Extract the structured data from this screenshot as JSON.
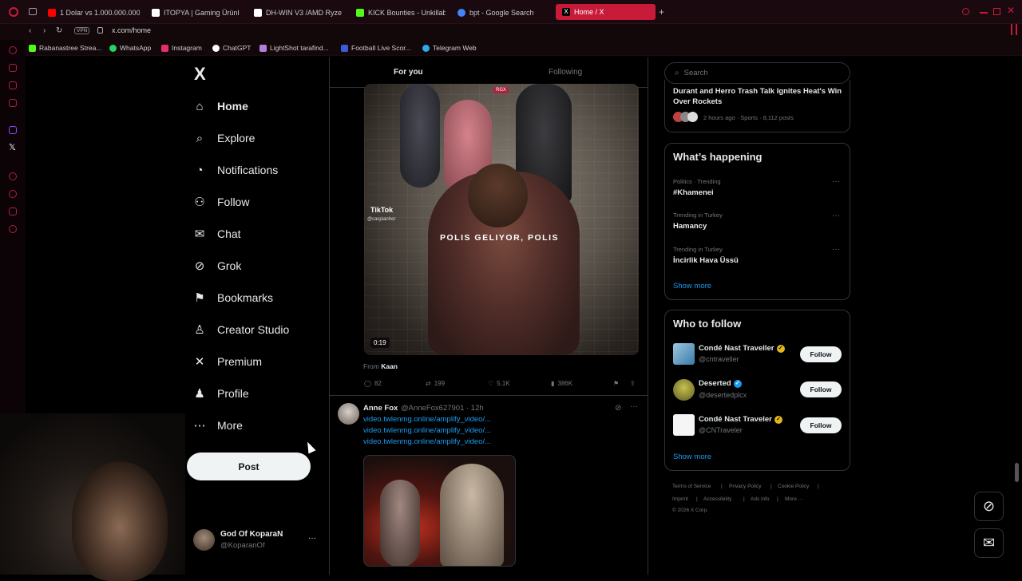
{
  "browser": {
    "tabs": [
      {
        "label": "1 Dolar vs 1.000.000.000 D",
        "color": "#ff0000"
      },
      {
        "label": "ITOPYA | Gaming Ürünler",
        "color": "#ffffff"
      },
      {
        "label": "DH-WIN V3 /AMD Ryzen",
        "color": "#ffffff"
      },
      {
        "label": "KICK Bounties - Unkillable",
        "color": "#53fc18"
      },
      {
        "label": "bpt - Google Search",
        "color": "#4285f4"
      },
      {
        "label": "Home / X",
        "color": "#000000"
      }
    ],
    "new_tab": "+",
    "url": "x.com/home",
    "vpn_label": "VPN",
    "bookmarks": [
      {
        "label": "Rabanastree Strea...",
        "color": "#53fc18"
      },
      {
        "label": "WhatsApp",
        "color": "#25d366"
      },
      {
        "label": "Instagram",
        "color": "#e1306c"
      },
      {
        "label": "ChatGPT",
        "color": "#ffffff"
      },
      {
        "label": "LightShot tarafind...",
        "color": "#b57edc"
      },
      {
        "label": "Football Live Scor...",
        "color": "#3b5bdb"
      },
      {
        "label": "Telegram Web",
        "color": "#2aabee"
      }
    ]
  },
  "nav": {
    "logo": "X",
    "items": [
      {
        "label": "Home",
        "icon": "home-icon"
      },
      {
        "label": "Explore",
        "icon": "search-icon"
      },
      {
        "label": "Notifications",
        "icon": "bell-icon"
      },
      {
        "label": "Follow",
        "icon": "person-add-icon"
      },
      {
        "label": "Chat",
        "icon": "mail-icon"
      },
      {
        "label": "Grok",
        "icon": "grok-icon"
      },
      {
        "label": "Bookmarks",
        "icon": "bookmark-icon"
      },
      {
        "label": "Creator Studio",
        "icon": "creator-icon"
      },
      {
        "label": "Premium",
        "icon": "x-icon"
      },
      {
        "label": "Profile",
        "icon": "person-icon"
      },
      {
        "label": "More",
        "icon": "more-icon"
      }
    ],
    "post_label": "Post",
    "account": {
      "name": "God Of KoparaN",
      "handle": "@KoparanOf",
      "more": "···"
    }
  },
  "feed": {
    "tabs": [
      "For you",
      "Following"
    ],
    "video_post": {
      "badge": "RGX",
      "tiktok_label": "TikTok",
      "tiktok_handle": "@caspianher",
      "caption": "POLIS GELIYOR, POLIS",
      "duration": "0:19",
      "from_label": "From",
      "from_name": "Kaan",
      "replies": "82",
      "reposts": "199",
      "likes": "5.1K",
      "views": "386K"
    },
    "second_post": {
      "name": "Anne Fox",
      "handle_time": "@AnneFox627901 · 12h",
      "links": [
        "video.twlenmg.online/amplify_video/...",
        "video.twlenmg.online/amplify_video/...",
        "video.twlenmg.online/amplify_video/..."
      ]
    }
  },
  "right": {
    "search_placeholder": "Search",
    "top_story": {
      "title": "Durant and Herro Trash Talk Ignites Heat's Win Over Rockets",
      "meta": "2 hours ago · Sports · 8,112 posts"
    },
    "happening": {
      "title": "What’s happening",
      "trends": [
        {
          "context": "Politics · Trending",
          "name": "#Khamenei"
        },
        {
          "context": "Trending in Turkey",
          "name": "Hamancy"
        },
        {
          "context": "Trending in Turkey",
          "name": "İncirlik Hava Üssü"
        }
      ],
      "show_more": "Show more"
    },
    "who_to_follow": {
      "title": "Who to follow",
      "accounts": [
        {
          "name": "Condé Nast Traveller",
          "handle": "@cntraveller",
          "badge_color": "#e2b719"
        },
        {
          "name": "Deserted",
          "handle": "@desertedplcx",
          "badge_color": "#1d9bf0"
        },
        {
          "name": "Condé Nast Traveler",
          "handle": "@CNTraveler",
          "badge_color": "#e2b719"
        }
      ],
      "follow_label": "Follow",
      "show_more": "Show more"
    },
    "footer": {
      "links": [
        "Terms of Service",
        "Privacy Policy",
        "Cookie Policy",
        "Imprint",
        "Accessibility",
        "Ads info",
        "More ···"
      ],
      "copyright": "© 2026 X Corp."
    }
  },
  "colors": {
    "accent": "#1d9bf0",
    "browser_accent": "#c81b3a"
  }
}
